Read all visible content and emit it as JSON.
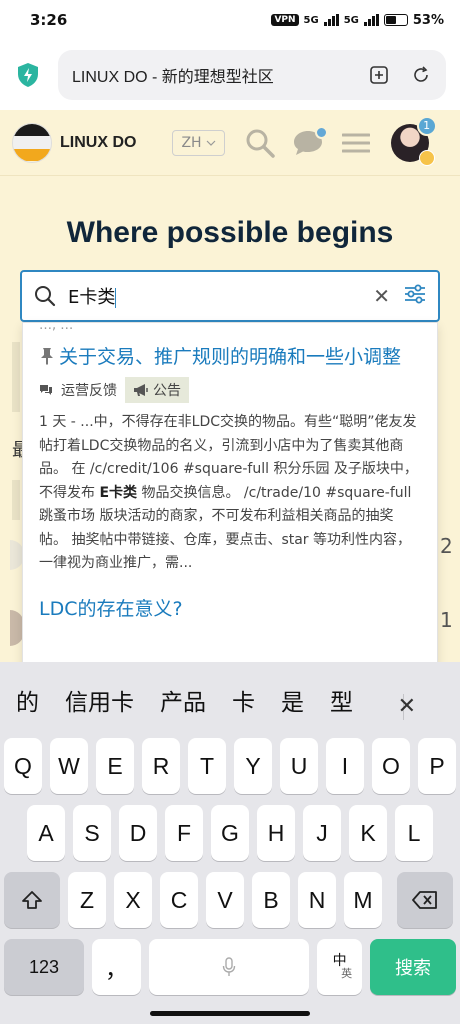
{
  "status": {
    "time": "3:26",
    "vpn": "VPN",
    "sig1": "5G",
    "sig2": "5G",
    "battery": "53%",
    "battery_level": 0.53
  },
  "browser": {
    "page_title": "LINUX DO - 新的理想型社区"
  },
  "site": {
    "name": "LINUX DO",
    "lang": "ZH",
    "notif_count": "1",
    "hero": "Where possible begins",
    "peek_char": "最",
    "peek_digit1": "2",
    "peek_digit2": "1"
  },
  "search": {
    "query": "E卡类"
  },
  "results": [
    {
      "cut_text": "…, …",
      "title": "关于交易、推广规则的明确和一些小调整",
      "category": "运营反馈",
      "tag": "公告",
      "excerpt_pre": "1 天 - ...中，不得存在非LDC交换的物品。有些“聪明”佬友发帖打着LDC交换物品的名义，引流到小店中为了售卖其他商品。 在 /c/credit/106 #square-full 积分乐园 及子版块中，不得发布 ",
      "excerpt_hl": "E卡类",
      "excerpt_post": " 物品交换信息。 /c/trade/10 #square-full 跳蚤市场 版块活动的商家，不可发布利益相关商品的抽奖帖。 抽奖帖中带链接、仓库，要点击、star 等功利性内容，一律视为商业推广，需..."
    },
    {
      "title": "LDC的存在意义?"
    }
  ],
  "keyboard": {
    "candidates": [
      "的",
      "信用卡",
      "产品",
      "卡",
      "是",
      "型"
    ],
    "row1": [
      "Q",
      "W",
      "E",
      "R",
      "T",
      "Y",
      "U",
      "I",
      "O",
      "P"
    ],
    "row2": [
      "A",
      "S",
      "D",
      "F",
      "G",
      "H",
      "J",
      "K",
      "L"
    ],
    "row3": [
      "Z",
      "X",
      "C",
      "V",
      "B",
      "N",
      "M"
    ],
    "num_label": "123",
    "comma": "，",
    "zh_top": "中",
    "zh_bottom": "英",
    "go_label": "搜索"
  }
}
